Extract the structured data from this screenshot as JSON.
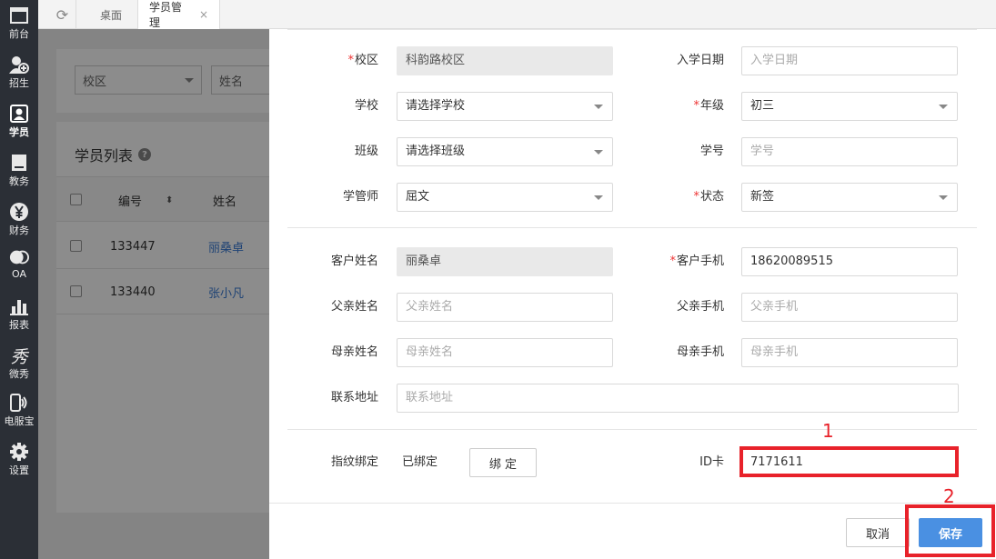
{
  "sidebar": {
    "items": [
      {
        "label": "前台",
        "icon": "window-icon"
      },
      {
        "label": "招生",
        "icon": "add-user-icon"
      },
      {
        "label": "学员",
        "icon": "student-icon"
      },
      {
        "label": "教务",
        "icon": "book-icon"
      },
      {
        "label": "财务",
        "icon": "yen-icon"
      },
      {
        "label": "OA",
        "icon": "chat-icon"
      },
      {
        "label": "报表",
        "icon": "bar-chart-icon"
      },
      {
        "label": "微秀",
        "icon": "xiu-icon"
      },
      {
        "label": "电服宝",
        "icon": "phone-service-icon"
      },
      {
        "label": "设置",
        "icon": "gear-icon"
      }
    ]
  },
  "tabs": [
    {
      "label": "桌面"
    },
    {
      "label": "学员管理",
      "close": "×"
    }
  ],
  "background": {
    "filter_campus": "校区",
    "filter_name": "姓名",
    "list_title": "学员列表",
    "help_icon": "?",
    "columns": {
      "number": "编号",
      "name": "姓名"
    },
    "rows": [
      {
        "number": "133447",
        "name": "丽桑卓"
      },
      {
        "number": "133440",
        "name": "张小凡"
      }
    ]
  },
  "form": {
    "campus": {
      "label": "校区",
      "value": "科韵路校区"
    },
    "enroll_date": {
      "label": "入学日期",
      "placeholder": "入学日期"
    },
    "school": {
      "label": "学校",
      "value": "请选择学校"
    },
    "grade": {
      "label": "年级",
      "value": "初三"
    },
    "class": {
      "label": "班级",
      "value": "请选择班级"
    },
    "student_no": {
      "label": "学号",
      "placeholder": "学号"
    },
    "manager": {
      "label": "学管师",
      "value": "屈文"
    },
    "status": {
      "label": "状态",
      "value": "新签"
    },
    "customer_name": {
      "label": "客户姓名",
      "value": "丽桑卓"
    },
    "customer_phone": {
      "label": "客户手机",
      "value": "18620089515"
    },
    "father_name": {
      "label": "父亲姓名",
      "placeholder": "父亲姓名"
    },
    "father_phone": {
      "label": "父亲手机",
      "placeholder": "父亲手机"
    },
    "mother_name": {
      "label": "母亲姓名",
      "placeholder": "母亲姓名"
    },
    "mother_phone": {
      "label": "母亲手机",
      "placeholder": "母亲手机"
    },
    "address": {
      "label": "联系地址",
      "placeholder": "联系地址"
    },
    "fingerprint": {
      "label": "指纹绑定",
      "status": "已绑定",
      "button": "绑 定"
    },
    "id_card": {
      "label": "ID卡",
      "value": "7171611"
    },
    "required_mark": "*"
  },
  "footer": {
    "cancel": "取消",
    "save": "保存"
  },
  "annotations": {
    "one": "1",
    "two": "2",
    "color": "#e8222a"
  }
}
